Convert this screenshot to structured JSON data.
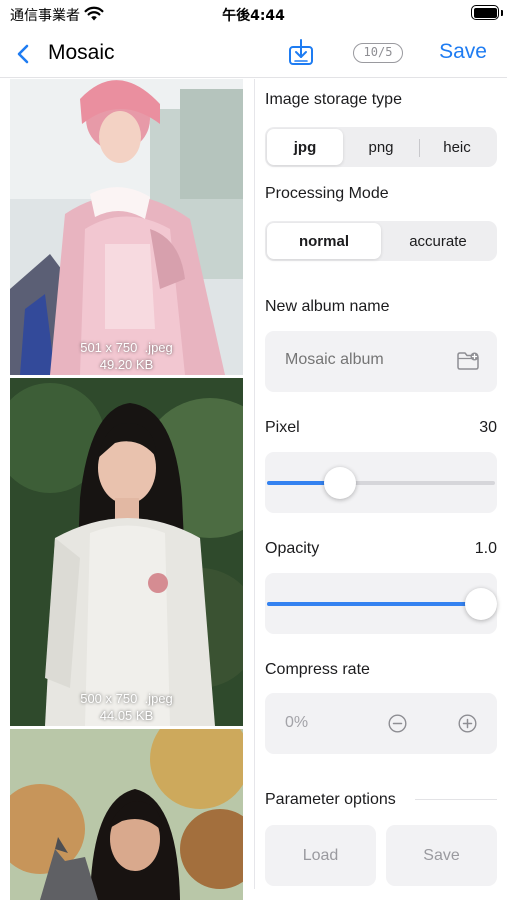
{
  "status_bar": {
    "carrier": "通信事業者",
    "time": "午後4:44"
  },
  "nav": {
    "back_icon": "chevron-left-icon",
    "title": "Mosaic",
    "counter": "10/5",
    "save_label": "Save",
    "accent_color": "#1e7cf2"
  },
  "images": [
    {
      "dimensions": "501 x 750",
      "format": ".jpeg",
      "size": "49.20 KB"
    },
    {
      "dimensions": "500 x 750",
      "format": ".jpeg",
      "size": "44.05 KB"
    },
    {
      "dimensions": "",
      "format": "",
      "size": ""
    }
  ],
  "settings": {
    "storage_type": {
      "label": "Image storage type",
      "options": [
        "jpg",
        "png",
        "heic"
      ],
      "selected": "jpg"
    },
    "processing_mode": {
      "label": "Processing Mode",
      "options": [
        "normal",
        "accurate"
      ],
      "selected": "normal"
    },
    "album": {
      "label": "New album name",
      "placeholder": "Mosaic album"
    },
    "pixel": {
      "label": "Pixel",
      "value": "30",
      "fraction": 0.32
    },
    "opacity": {
      "label": "Opacity",
      "value": "1.0",
      "fraction": 1.0
    },
    "compress": {
      "label": "Compress rate",
      "value": "0%"
    },
    "parameter_options": {
      "label": "Parameter options",
      "load_label": "Load",
      "save_label": "Save"
    }
  }
}
